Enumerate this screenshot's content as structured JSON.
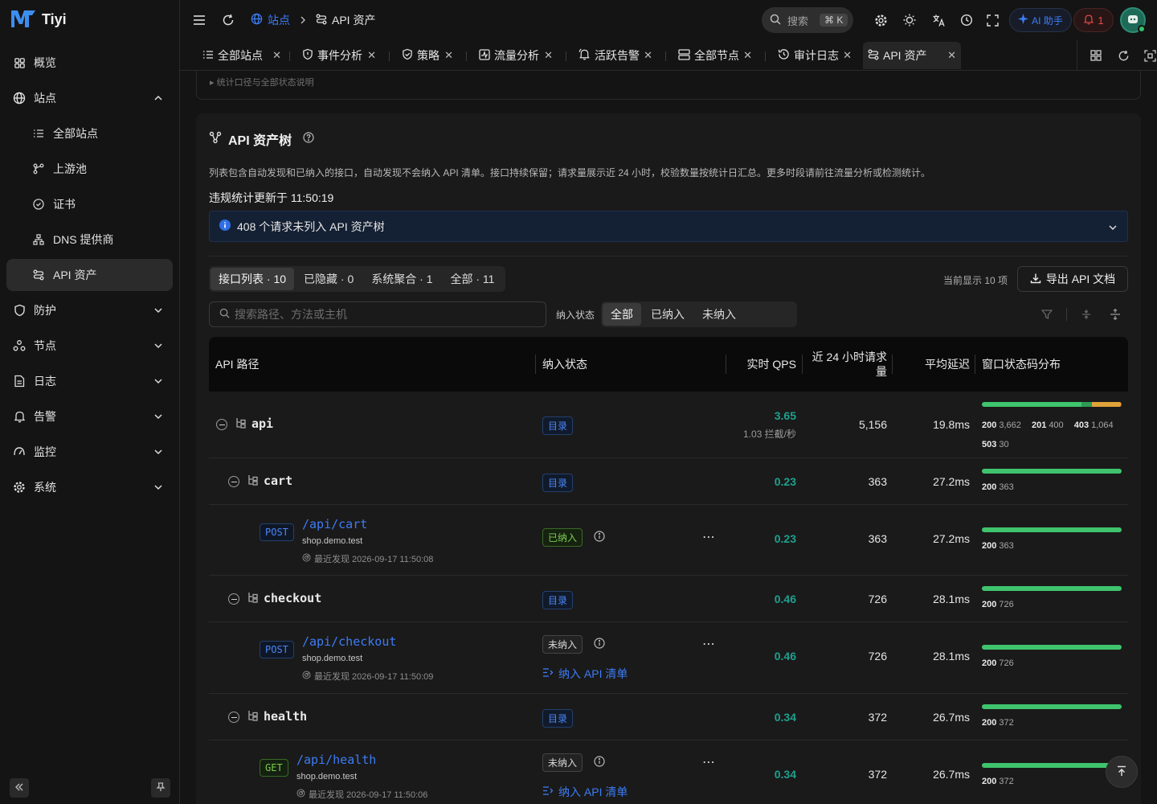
{
  "app": {
    "name": "Tiyi"
  },
  "sidebar": {
    "items": [
      {
        "label": "概览",
        "icon": "grid-icon"
      },
      {
        "label": "站点",
        "icon": "globe-icon"
      },
      {
        "label": "全部站点",
        "icon": "list-icon"
      },
      {
        "label": "上游池",
        "icon": "branch-icon"
      },
      {
        "label": "证书",
        "icon": "badge-check-icon"
      },
      {
        "label": "DNS 提供商",
        "icon": "network-icon"
      },
      {
        "label": "API 资产",
        "icon": "route-icon"
      },
      {
        "label": "防护",
        "icon": "shield-icon"
      },
      {
        "label": "节点",
        "icon": "cluster-icon"
      },
      {
        "label": "日志",
        "icon": "document-icon"
      },
      {
        "label": "告警",
        "icon": "bell-icon"
      },
      {
        "label": "监控",
        "icon": "gauge-icon"
      },
      {
        "label": "系统",
        "icon": "gear-icon"
      }
    ]
  },
  "header": {
    "breadcrumb": [
      "站点",
      "API 资产"
    ],
    "search_label": "搜索",
    "search_shortcut": "⌘ K",
    "ai_label": "AI 助手",
    "alert_count": "1"
  },
  "tabs": [
    {
      "label": "全部站点",
      "icon": "list-icon"
    },
    {
      "label": "事件分析",
      "icon": "shield-alert-icon"
    },
    {
      "label": "策略",
      "icon": "shield-check-icon"
    },
    {
      "label": "流量分析",
      "icon": "activity-icon"
    },
    {
      "label": "活跃告警",
      "icon": "bell-ring-icon"
    },
    {
      "label": "全部节点",
      "icon": "server-icon"
    },
    {
      "label": "审计日志",
      "icon": "history-icon"
    },
    {
      "label": "API 资产",
      "icon": "route-icon"
    }
  ],
  "prev_card": {
    "summary": "▸ 统计口径与全部状态说明"
  },
  "panel": {
    "title": "API 资产树",
    "description": "列表包含自动发现和已纳入的接口，自动发现不会纳入 API 清单。接口持续保留；请求量展示近 24 小时，校验数量按统计日汇总。更多时段请前往流量分析或检测统计。",
    "stats_updated": "违规统计更新于 11:50:19",
    "banner": "408 个请求未列入 API 资产树",
    "view_tabs": [
      "接口列表 · 10",
      "已隐藏 · 0",
      "系统聚合 · 1",
      "全部 · 11"
    ],
    "showing": "当前显示 10 项",
    "export_label": "导出 API 文档",
    "search_placeholder": "搜索路径、方法或主机",
    "filter_label": "纳入状态",
    "filter_options": [
      "全部",
      "已纳入",
      "未纳入"
    ]
  },
  "table": {
    "columns": {
      "path": "API 路径",
      "status": "纳入状态",
      "qps": "实时 QPS",
      "requests_line1": "近 24 小时请求",
      "requests_line2": "量",
      "latency": "平均延迟",
      "dist": "窗口状态码分布"
    },
    "add_label": "纳入 API 清单",
    "rows": [
      {
        "kind": "group",
        "label": "api",
        "status": "目录",
        "qps": "3.65",
        "qps_sub": "1.03 拦截/秒",
        "requests": "5,156",
        "latency": "19.8ms",
        "codes": [
          {
            "code": "200",
            "count": "3,662",
            "value": 3662
          },
          {
            "code": "201",
            "count": "400",
            "value": 400
          },
          {
            "code": "403",
            "count": "1,064",
            "value": 1064
          },
          {
            "code": "503",
            "count": "30",
            "value": 30
          }
        ]
      },
      {
        "kind": "group",
        "label": "cart",
        "status": "目录",
        "qps": "0.23",
        "requests": "363",
        "latency": "27.2ms",
        "codes": [
          {
            "code": "200",
            "count": "363",
            "value": 363
          }
        ]
      },
      {
        "kind": "leaf",
        "method": "POST",
        "path": "/api/cart",
        "host": "shop.demo.test",
        "seen": "最近发现 2026-09-17 11:50:08",
        "status": "已纳入",
        "qps": "0.23",
        "requests": "363",
        "latency": "27.2ms",
        "codes": [
          {
            "code": "200",
            "count": "363",
            "value": 363
          }
        ]
      },
      {
        "kind": "group",
        "label": "checkout",
        "status": "目录",
        "qps": "0.46",
        "requests": "726",
        "latency": "28.1ms",
        "codes": [
          {
            "code": "200",
            "count": "726",
            "value": 726
          }
        ]
      },
      {
        "kind": "leaf",
        "method": "POST",
        "path": "/api/checkout",
        "host": "shop.demo.test",
        "seen": "最近发现 2026-09-17 11:50:09",
        "status": "未纳入",
        "qps": "0.46",
        "requests": "726",
        "latency": "28.1ms",
        "codes": [
          {
            "code": "200",
            "count": "726",
            "value": 726
          }
        ]
      },
      {
        "kind": "group",
        "label": "health",
        "status": "目录",
        "qps": "0.34",
        "requests": "372",
        "latency": "26.7ms",
        "codes": [
          {
            "code": "200",
            "count": "372",
            "value": 372
          }
        ]
      },
      {
        "kind": "leaf",
        "method": "GET",
        "path": "/api/health",
        "host": "shop.demo.test",
        "seen": "最近发现 2026-09-17 11:50:06",
        "status": "未纳入",
        "qps": "0.34",
        "requests": "372",
        "latency": "26.7ms",
        "codes": [
          {
            "code": "200",
            "count": "372",
            "value": 372
          }
        ]
      }
    ]
  },
  "colors": {
    "accent": "#3c7cf6",
    "qps": "#1fa08e",
    "code_200": "#3fc46d",
    "code_201": "#2e9a55",
    "code_403": "#e0a33a",
    "code_503": "#e03a3a"
  }
}
